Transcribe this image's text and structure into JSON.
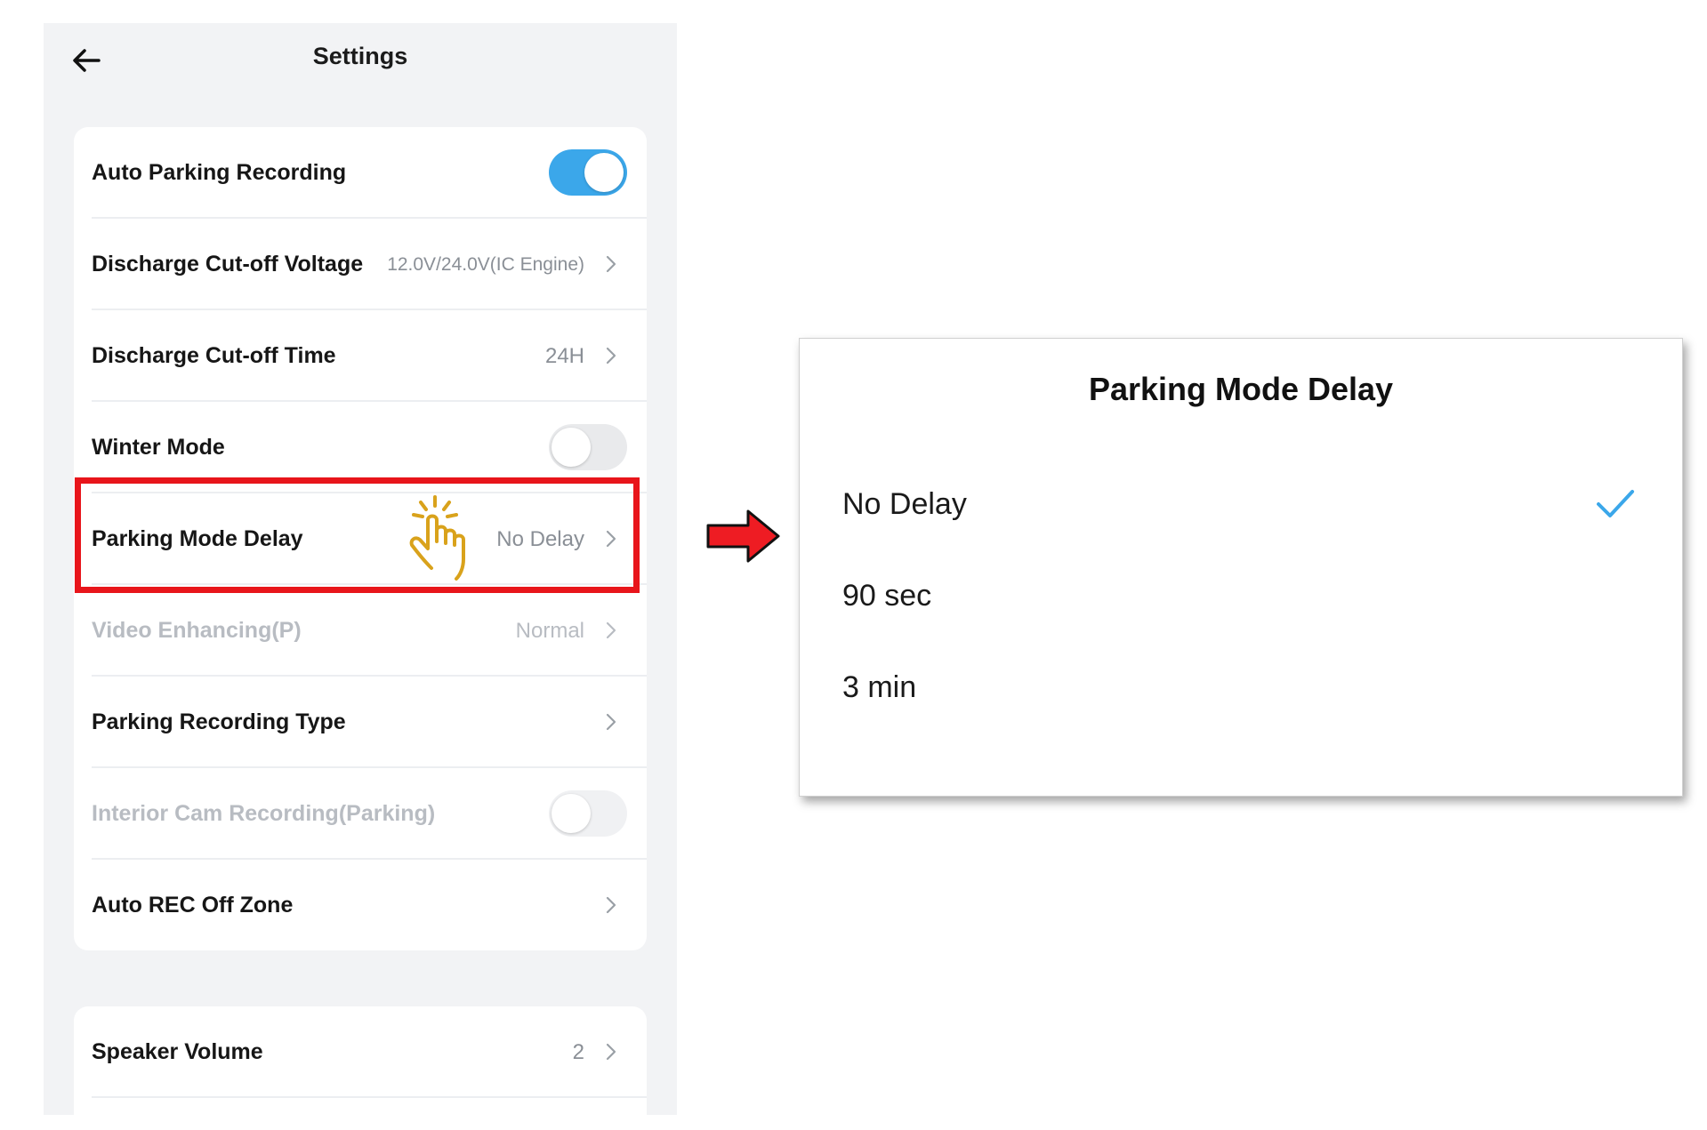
{
  "header": {
    "title": "Settings"
  },
  "settings": [
    {
      "label": "Auto Parking Recording",
      "control": "toggle",
      "on": true,
      "disabled": false
    },
    {
      "label": "Discharge Cut-off Voltage",
      "value": "12.0V/24.0V(IC Engine)",
      "control": "chevron",
      "disabled": false
    },
    {
      "label": "Discharge Cut-off Time",
      "value": "24H",
      "control": "chevron",
      "disabled": false
    },
    {
      "label": "Winter Mode",
      "control": "toggle",
      "on": false,
      "disabled": false
    },
    {
      "label": "Parking Mode Delay",
      "value": "No Delay",
      "control": "chevron",
      "disabled": false
    },
    {
      "label": "Video Enhancing(P)",
      "value": "Normal",
      "control": "chevron",
      "disabled": true
    },
    {
      "label": "Parking Recording Type",
      "control": "chevron",
      "disabled": false
    },
    {
      "label": "Interior Cam Recording(Parking)",
      "control": "toggle",
      "on": false,
      "disabled": true
    },
    {
      "label": "Auto REC Off Zone",
      "control": "chevron",
      "disabled": false
    }
  ],
  "settings2": [
    {
      "label": "Speaker Volume",
      "value": "2",
      "control": "chevron",
      "disabled": false
    }
  ],
  "dialog": {
    "title": "Parking Mode Delay",
    "options": [
      {
        "label": "No Delay",
        "selected": true
      },
      {
        "label": "90 sec",
        "selected": false
      },
      {
        "label": "3 min",
        "selected": false
      }
    ]
  },
  "colors": {
    "accent": "#3ba7ea",
    "highlight": "#e8151b",
    "arrow": "#ee1c23",
    "hand": "#d9a21b"
  },
  "icons": {
    "back": "arrow-left-icon",
    "chevron": "chevron-right-icon",
    "tap": "tap-hand-icon",
    "pointer": "red-arrow-icon",
    "selected": "checkmark-icon"
  }
}
